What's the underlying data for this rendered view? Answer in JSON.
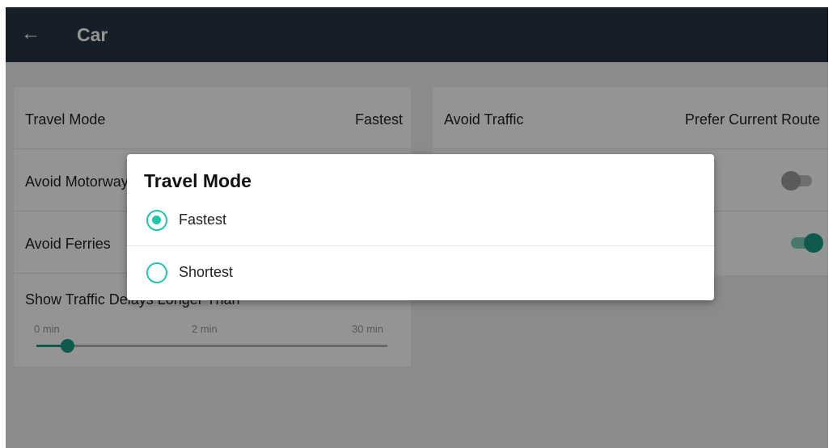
{
  "appbar": {
    "title": "Car",
    "back_icon": "arrow-left-icon"
  },
  "settings": {
    "travel_mode": {
      "label": "Travel Mode",
      "value": "Fastest"
    },
    "avoid_motorways": {
      "label": "Avoid Motorways",
      "enabled": false
    },
    "avoid_ferries": {
      "label": "Avoid Ferries",
      "enabled": true
    },
    "show_traffic_delays": {
      "label": "Show Traffic Delays Longer Than",
      "scale_labels": [
        "0 min",
        "2 min",
        "30 min"
      ],
      "selected": "2 min"
    },
    "avoid_traffic": {
      "label": "Avoid Traffic",
      "value": "Prefer Current Route"
    },
    "right_toggle_1": {
      "enabled": false
    },
    "right_toggle_2": {
      "enabled": true
    }
  },
  "dialog": {
    "title": "Travel Mode",
    "options": [
      {
        "label": "Fastest",
        "selected": true
      },
      {
        "label": "Shortest",
        "selected": false
      }
    ]
  },
  "colors": {
    "appbar": "#263646",
    "accent": "#1fc7ac",
    "toggle_on": "#199b85",
    "toggle_off": "#9e9e9e"
  }
}
